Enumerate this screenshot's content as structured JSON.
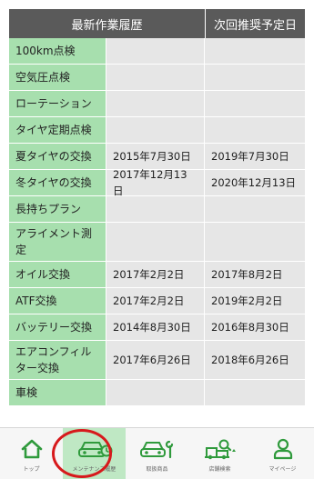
{
  "header": {
    "col1": "最新作業履歴",
    "col2": "次回推奨予定日"
  },
  "rows": [
    {
      "name": "100km点検",
      "last": "",
      "next": ""
    },
    {
      "name": "空気圧点検",
      "last": "",
      "next": ""
    },
    {
      "name": "ローテーション",
      "last": "",
      "next": ""
    },
    {
      "name": "タイヤ定期点検",
      "last": "",
      "next": ""
    },
    {
      "name": "夏タイヤの交換",
      "last": "2015年7月30日",
      "next": "2019年7月30日"
    },
    {
      "name": "冬タイヤの交換",
      "last": "2017年12月13日",
      "next": "2020年12月13日"
    },
    {
      "name": "長持ちプラン",
      "last": "",
      "next": ""
    },
    {
      "name": "アライメント測定",
      "last": "",
      "next": ""
    },
    {
      "name": "オイル交換",
      "last": "2017年2月2日",
      "next": "2017年8月2日"
    },
    {
      "name": "ATF交換",
      "last": "2017年2月2日",
      "next": "2019年2月2日"
    },
    {
      "name": "バッテリー交換",
      "last": "2014年8月30日",
      "next": "2016年8月30日"
    },
    {
      "name": "エアコンフィルター交換",
      "last": "2017年6月26日",
      "next": "2018年6月26日"
    },
    {
      "name": "車検",
      "last": "",
      "next": ""
    }
  ],
  "nav": [
    {
      "label": "トップ",
      "icon": "home-icon",
      "active": false
    },
    {
      "label": "メンテナンス履歴",
      "icon": "car-maintenance-icon",
      "active": true
    },
    {
      "label": "取扱商品",
      "icon": "car-wrench-icon",
      "active": false
    },
    {
      "label": "店舗検索",
      "icon": "store-search-icon",
      "active": false
    },
    {
      "label": "マイページ",
      "icon": "person-icon",
      "active": false
    }
  ],
  "colors": {
    "accent": "#2f9a3c",
    "name_cell": "#a7dfae",
    "date_cell": "#e6e6e6",
    "header": "#5a5a5a",
    "highlight_ring": "#d7191c"
  }
}
